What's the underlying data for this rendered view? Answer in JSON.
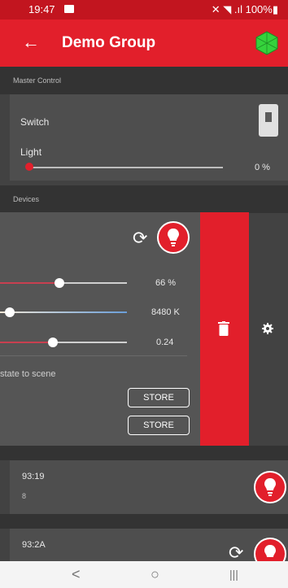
{
  "status_bar": {
    "time": "19:47",
    "right_text": "✕ ◥ .ıl 100%▮"
  },
  "appbar": {
    "back_icon": "arrow-left-icon",
    "title": "Demo Group",
    "logo_icon": "green-hex-logo"
  },
  "master": {
    "section_label": "Master Control",
    "switch_label": "Switch",
    "light_label": "Light",
    "light_value": "0 %",
    "light_fraction": 0.0
  },
  "devices": {
    "section_label": "Devices",
    "expanded_device": {
      "brightness_value": "66 %",
      "brightness_fraction": 0.66,
      "temperature_value": "8480 K",
      "third_value": "0.24",
      "third_fraction": 0.24,
      "scene_label": "state to scene",
      "store_label_1": "STORE",
      "store_label_2": "STORE"
    },
    "items": [
      {
        "name": "93:19",
        "sub": "8"
      },
      {
        "name": "93:2A"
      }
    ]
  },
  "colors": {
    "accent": "#e21f2b",
    "statusbar": "#c2151f",
    "panel": "#4e4e4e",
    "background": "#424242"
  },
  "navbar": {
    "back": "<",
    "home": "○",
    "recents": "|||"
  }
}
